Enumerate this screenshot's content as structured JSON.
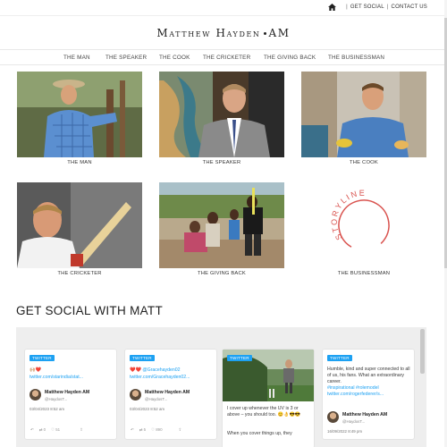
{
  "topbar": {
    "home_icon": "home-icon",
    "get_social": "GET SOCIAL",
    "contact_us": "CONTACT US",
    "separator": "|"
  },
  "brand": {
    "first": "Matthew Hayden",
    "suffix": "AM"
  },
  "nav": [
    {
      "label": "THE MAN"
    },
    {
      "label": "THE SPEAKER"
    },
    {
      "label": "THE COOK"
    },
    {
      "label": "THE CRICKETER"
    },
    {
      "label": "THE GIVING BACK"
    },
    {
      "label": "THE BUSINESSMAN"
    }
  ],
  "tiles": [
    {
      "caption": "THE MAN"
    },
    {
      "caption": "THE SPEAKER"
    },
    {
      "caption": "THE COOK"
    },
    {
      "caption": "THE CRICKETER"
    },
    {
      "caption": "THE GIVING BACK"
    },
    {
      "caption": "THE BUSINESSMAN",
      "logo_text": "STORYLINE"
    }
  ],
  "social": {
    "title": "GET SOCIAL WITH MATT",
    "cards": [
      {
        "badge": "TWITTER",
        "emoji": "🙌🏼❤️",
        "link": "twitter.com/starindia/stat...",
        "author": "Matthew Hayden AM",
        "handle": "@HaydosT...",
        "date": "03/04/2023 8:52 am",
        "reply": "",
        "retweets": "0",
        "likes": "51"
      },
      {
        "badge": "TWITTER",
        "mention": "❤️❤️ @Gracehayden02",
        "link": "twitter.com/Gracehayden02...",
        "author": "Matthew Hayden AM",
        "handle": "@HaydosT...",
        "date": "03/04/2023 8:52 am",
        "reply": "",
        "retweets": "5",
        "likes": "890"
      },
      {
        "badge": "TWITTER",
        "text1": "I cover up whenever the UV is 3 or above – you should too. 😊👌😎😎",
        "text2": "When you cover things up, they"
      },
      {
        "badge": "TWITTER",
        "text": "Humble, kind and super connected to all of us, his fans. What an extraordinary career.",
        "tags": "#inspirational #rolemodel",
        "link": "twitter.com/rogerfederer/s...",
        "author": "Matthew Hayden AM",
        "handle": "@HaydosT...",
        "date": "16/09/2022 8:49 pm"
      }
    ]
  },
  "colors": {
    "twitter_blue": "#1da1f2",
    "storyline_red": "#d9534f",
    "panel_grey": "#eeeeee"
  }
}
